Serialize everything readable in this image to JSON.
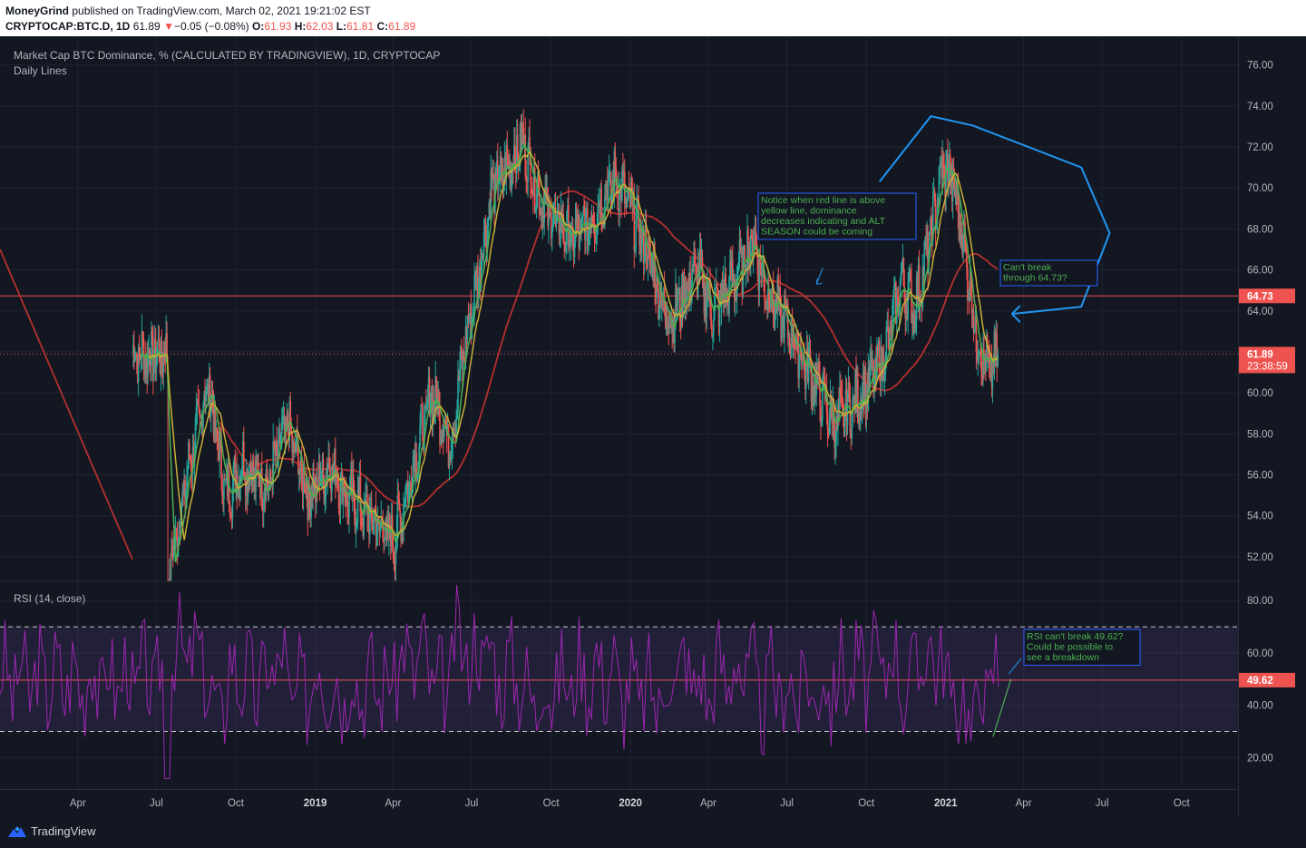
{
  "header": {
    "author": "MoneyGrind",
    "published": "published on TradingView.com, March 02, 2021 19:21:02 EST",
    "symbol": "CRYPTOCAP:BTC.D, 1D",
    "last": "61.89",
    "arrow": "▼",
    "change": "−0.05 (−0.08%)",
    "o_label": "O:",
    "o": "61.93",
    "h_label": "H:",
    "h": "62.03",
    "l_label": "L:",
    "l": "61.81",
    "c_label": "C:",
    "c": "61.89"
  },
  "chart_data": [
    {
      "type": "line",
      "title": "Market Cap BTC Dominance, % (CALCULATED BY TRADINGVIEW), 1D, CRYPTOCAP",
      "subtitle": "Daily Lines",
      "y_ticks": [
        52,
        54,
        56,
        58,
        60,
        62,
        64,
        66,
        68,
        70,
        72,
        74,
        76
      ],
      "y_tick_labels": [
        "52.00",
        "54.00",
        "56.00",
        "58.00",
        "60.00",
        "62.00",
        "64.00",
        "66.00",
        "68.00",
        "70.00",
        "72.00",
        "74.00",
        "76.00"
      ],
      "ylim": [
        50.8,
        77.4
      ],
      "x_tick_labels": [
        "Apr",
        "Jul",
        "Oct",
        "2019",
        "Apr",
        "Jul",
        "Oct",
        "2020",
        "Apr",
        "Jul",
        "Oct",
        "2021",
        "Apr",
        "Jul",
        "Oct"
      ],
      "x_tick_bold": [
        false,
        false,
        false,
        true,
        false,
        false,
        false,
        true,
        false,
        false,
        false,
        true,
        false,
        false,
        false
      ],
      "x_tick_t": [
        2018.247,
        2018.496,
        2018.748,
        2019.0,
        2019.247,
        2019.496,
        2019.748,
        2020.0,
        2020.247,
        2020.496,
        2020.748,
        2021.0,
        2021.247,
        2021.496,
        2021.748
      ],
      "xlim": [
        2018.0,
        2021.93
      ],
      "last_t": 2021.167,
      "close_keypoints": [
        [
          2018.53,
          50.5
        ],
        [
          2018.6,
          56.5
        ],
        [
          2018.66,
          60.5
        ],
        [
          2018.69,
          57.5
        ],
        [
          2018.72,
          55
        ],
        [
          2018.77,
          56.5
        ],
        [
          2018.85,
          55.5
        ],
        [
          2018.91,
          58.5
        ],
        [
          2018.98,
          55
        ],
        [
          2019.05,
          56.5
        ],
        [
          2019.1,
          55
        ],
        [
          2019.17,
          54
        ],
        [
          2019.25,
          52.8
        ],
        [
          2019.32,
          57
        ],
        [
          2019.37,
          60
        ],
        [
          2019.43,
          57.5
        ],
        [
          2019.47,
          62
        ],
        [
          2019.52,
          66
        ],
        [
          2019.56,
          70
        ],
        [
          2019.61,
          71
        ],
        [
          2019.66,
          72.3
        ],
        [
          2019.7,
          70
        ],
        [
          2019.75,
          68.5
        ],
        [
          2019.82,
          67.5
        ],
        [
          2019.88,
          68.5
        ],
        [
          2019.95,
          70.5
        ],
        [
          2020.0,
          69
        ],
        [
          2020.05,
          67
        ],
        [
          2020.12,
          63.5
        ],
        [
          2020.16,
          64.5
        ],
        [
          2020.21,
          66
        ],
        [
          2020.26,
          64
        ],
        [
          2020.33,
          65.5
        ],
        [
          2020.39,
          67.5
        ],
        [
          2020.43,
          65
        ],
        [
          2020.49,
          63.5
        ],
        [
          2020.55,
          61.5
        ],
        [
          2020.6,
          60
        ],
        [
          2020.65,
          58.5
        ],
        [
          2020.71,
          59.5
        ],
        [
          2020.76,
          60.5
        ],
        [
          2020.81,
          62
        ],
        [
          2020.86,
          65.5
        ],
        [
          2020.9,
          64
        ],
        [
          2020.95,
          67.5
        ],
        [
          2020.99,
          71
        ],
        [
          2021.02,
          70.5
        ],
        [
          2021.06,
          67
        ],
        [
          2021.1,
          62.5
        ],
        [
          2021.14,
          61
        ],
        [
          2021.167,
          61.89
        ]
      ],
      "series": [
        {
          "name": "",
          "color": "#26a69a",
          "kind": "candles"
        },
        {
          "name": "",
          "color": "#4caf50",
          "kind": "ma",
          "period": 10
        },
        {
          "name": "",
          "color": "#c9b037",
          "kind": "ma",
          "period": 20
        },
        {
          "name": "",
          "color": "#b5302d",
          "kind": "ma",
          "period": 100
        }
      ],
      "horizontal_line": {
        "value": 64.73,
        "label": "64.73",
        "color": "#ef5350"
      },
      "last_price": {
        "value": 61.89,
        "label": "61.89",
        "countdown": "23:38:59"
      },
      "annotations": [
        {
          "text": [
            "Notice when red line is above",
            "yellow line, dominance",
            "decreases indicating and ALT",
            "SEASON could be coming"
          ],
          "color": "#4caf50",
          "box_color": "#2962ff"
        },
        {
          "text": [
            "Can't break",
            "through 64.73?"
          ],
          "color": "#4caf50",
          "box_color": "#2962ff"
        }
      ]
    },
    {
      "type": "line",
      "title": "RSI (14, close)",
      "y_ticks": [
        20,
        40,
        60,
        80
      ],
      "y_tick_labels": [
        "20.00",
        "40.00",
        "60.00",
        "80.00"
      ],
      "ylim": [
        8,
        87
      ],
      "bands": {
        "upper": 70,
        "lower": 30,
        "fill": "#7e57c2"
      },
      "horizontal_line": {
        "value": 49.62,
        "label": "49.62",
        "color": "#ef5350"
      },
      "series": [
        {
          "name": "",
          "color": "#9c27b0"
        }
      ],
      "annotations": [
        {
          "text": [
            "RSI can't break 49.62?",
            "Could be possible to",
            "see a breakdown"
          ],
          "color": "#4caf50",
          "box_color": "#2962ff"
        }
      ]
    }
  ],
  "footer": {
    "brand": "TradingView"
  },
  "colors": {
    "background": "#131722",
    "grid": "#1f2432",
    "up": "#26a69a",
    "down": "#ef5350",
    "drawing": "#2196f3",
    "text": "#b2b5be"
  }
}
